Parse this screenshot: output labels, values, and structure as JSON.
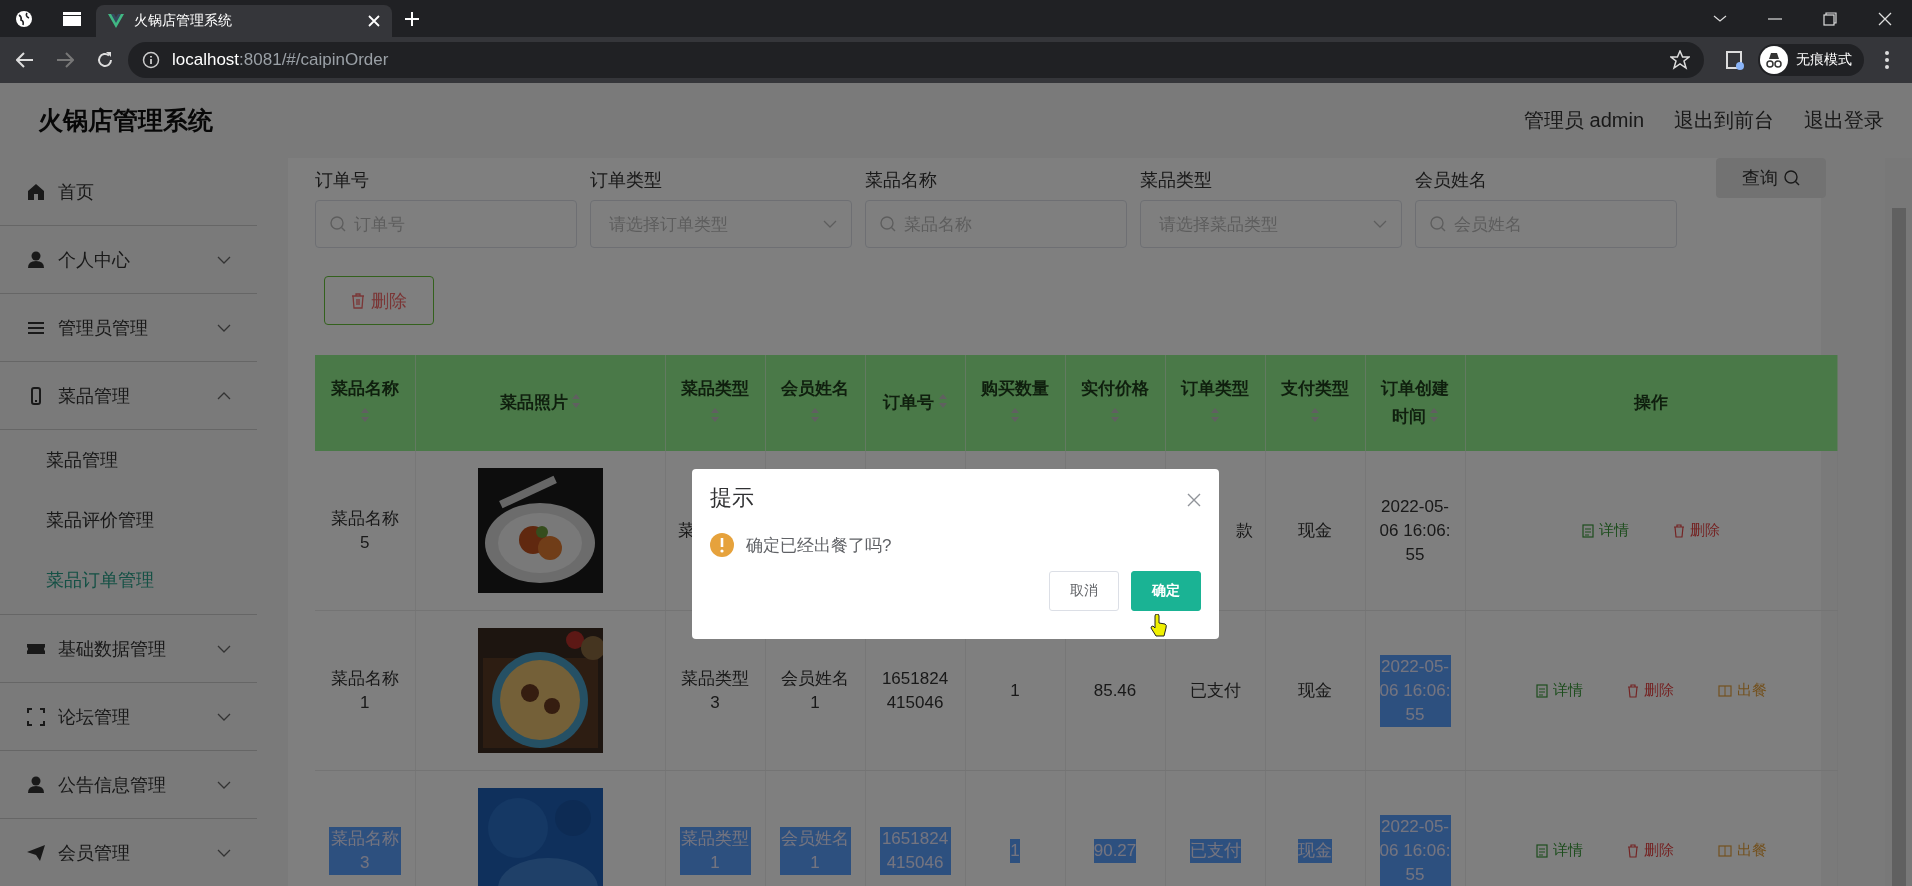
{
  "browser": {
    "tabs": [
      {
        "title": "火锅店管理系统",
        "selected": true
      }
    ],
    "url_host": "localhost",
    "url_rest": ":8081/#/caipinOrder",
    "profile_label": "无痕模式"
  },
  "header": {
    "title": "火锅店管理系统",
    "user": "管理员 admin",
    "links": [
      "退出到前台",
      "退出登录"
    ]
  },
  "sidebar": {
    "items": [
      {
        "label": "首页",
        "expandable": false
      },
      {
        "label": "个人中心",
        "expandable": true,
        "expanded": false
      },
      {
        "label": "管理员管理",
        "expandable": true,
        "expanded": false
      },
      {
        "label": "菜品管理",
        "expandable": true,
        "expanded": true,
        "children": [
          {
            "label": "菜品管理",
            "selected": false
          },
          {
            "label": "菜品评价管理",
            "selected": false
          },
          {
            "label": "菜品订单管理",
            "selected": true
          }
        ]
      },
      {
        "label": "基础数据管理",
        "expandable": true,
        "expanded": false
      },
      {
        "label": "论坛管理",
        "expandable": true,
        "expanded": false
      },
      {
        "label": "公告信息管理",
        "expandable": true,
        "expanded": false
      },
      {
        "label": "会员管理",
        "expandable": true,
        "expanded": false
      }
    ]
  },
  "search": {
    "fields": [
      {
        "label": "订单号",
        "kind": "text",
        "placeholder": "订单号"
      },
      {
        "label": "订单类型",
        "kind": "select",
        "placeholder": "请选择订单类型"
      },
      {
        "label": "菜品名称",
        "kind": "text",
        "placeholder": "菜品名称"
      },
      {
        "label": "菜品类型",
        "kind": "select",
        "placeholder": "请选择菜品类型"
      },
      {
        "label": "会员姓名",
        "kind": "text",
        "placeholder": "会员姓名"
      }
    ],
    "button": "查询"
  },
  "delete_button": "删除",
  "table": {
    "columns": [
      {
        "label": "菜品名称",
        "sortable": true
      },
      {
        "label": "菜品照片",
        "sortable": true
      },
      {
        "label": "菜品类型",
        "sortable": true
      },
      {
        "label": "会员姓名",
        "sortable": true
      },
      {
        "label": "订单号",
        "sortable": true
      },
      {
        "label": "购买数量",
        "sortable": true
      },
      {
        "label": "实付价格",
        "sortable": true
      },
      {
        "label": "订单类型",
        "sortable": true
      },
      {
        "label": "支付类型",
        "sortable": true
      },
      {
        "label": "订单创建时间",
        "sortable": true
      },
      {
        "label": "操作",
        "sortable": false
      }
    ],
    "rows": [
      {
        "cells": [
          {
            "kind": "text",
            "text": "菜品名称5",
            "highlighted": false
          },
          {
            "kind": "picture"
          },
          {
            "kind": "text",
            "text": "菜",
            "clipped_right": true,
            "highlighted": false
          },
          {
            "kind": "covered"
          },
          {
            "kind": "covered"
          },
          {
            "kind": "covered"
          },
          {
            "kind": "covered"
          },
          {
            "kind": "text",
            "text": "款",
            "clipped_left": true,
            "highlighted": false
          },
          {
            "kind": "text",
            "text": "现金",
            "highlighted": false
          },
          {
            "kind": "text",
            "text": "2022-05-06 16:06:55",
            "highlighted": false
          }
        ],
        "actions": [
          {
            "kind": "detail",
            "label": "详情"
          },
          {
            "kind": "delete",
            "label": "删除"
          }
        ]
      },
      {
        "cells": [
          {
            "kind": "text",
            "text": "菜品名称1",
            "highlighted": false
          },
          {
            "kind": "picture"
          },
          {
            "kind": "text",
            "text": "菜品类型3",
            "highlighted": false
          },
          {
            "kind": "text",
            "text": "会员姓名1",
            "highlighted": false
          },
          {
            "kind": "text",
            "text": "1651824415046",
            "highlighted": false
          },
          {
            "kind": "text",
            "text": "1",
            "highlighted": false
          },
          {
            "kind": "text",
            "text": "85.46",
            "highlighted": false
          },
          {
            "kind": "text",
            "text": "已支付",
            "highlighted": false
          },
          {
            "kind": "text",
            "text": "现金",
            "highlighted": false
          },
          {
            "kind": "text",
            "text": "2022-05-06 16:06:55",
            "highlighted": true
          }
        ],
        "actions": [
          {
            "kind": "detail",
            "label": "详情"
          },
          {
            "kind": "delete",
            "label": "删除"
          },
          {
            "kind": "serve",
            "label": "出餐"
          }
        ]
      },
      {
        "cells": [
          {
            "kind": "text",
            "text": "菜品名称3",
            "highlighted": true
          },
          {
            "kind": "picture"
          },
          {
            "kind": "text",
            "text": "菜品类型1",
            "highlighted": true
          },
          {
            "kind": "text",
            "text": "会员姓名1",
            "highlighted": true
          },
          {
            "kind": "text",
            "text": "1651824415046",
            "highlighted": true
          },
          {
            "kind": "text",
            "text": "1",
            "highlighted": true
          },
          {
            "kind": "text",
            "text": "90.27",
            "highlighted": true
          },
          {
            "kind": "text",
            "text": "已支付",
            "highlighted": true
          },
          {
            "kind": "text",
            "text": "现金",
            "highlighted": true
          },
          {
            "kind": "text",
            "text": "2022-05-06 16:06:55",
            "highlighted": true
          }
        ],
        "actions": [
          {
            "kind": "detail",
            "label": "详情"
          },
          {
            "kind": "delete",
            "label": "删除"
          },
          {
            "kind": "serve",
            "label": "出餐"
          }
        ]
      }
    ]
  },
  "dialog": {
    "title": "提示",
    "message": "确定已经出餐了吗?",
    "buttons": [
      {
        "kind": "cancel",
        "label": "取消"
      },
      {
        "kind": "confirm",
        "label": "确定"
      }
    ]
  }
}
